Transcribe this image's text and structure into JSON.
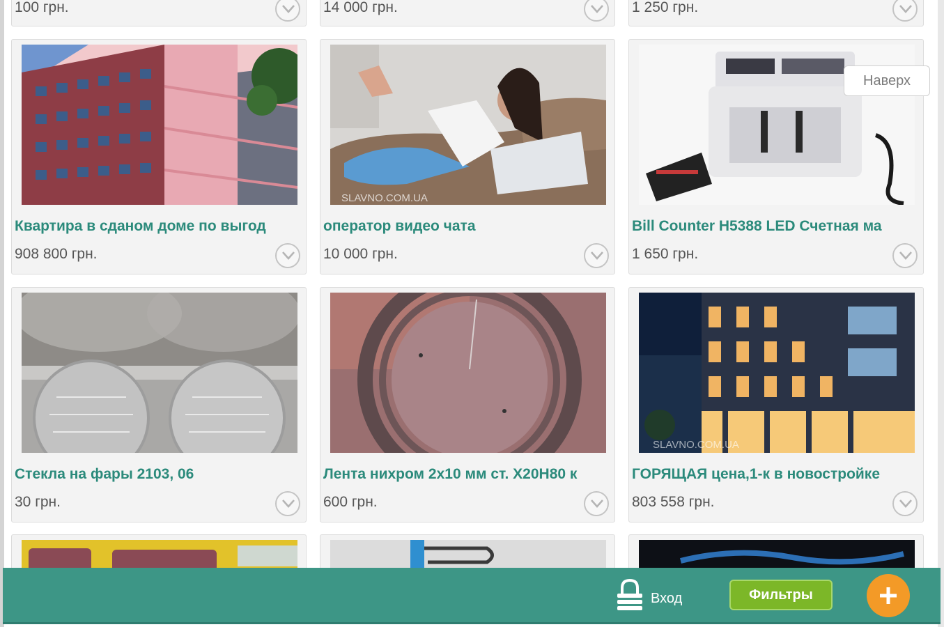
{
  "colors": {
    "title_text": "#2b8a7b",
    "price_text": "#555555",
    "bottom_bar": "#3d9686",
    "filters_button": "#7cb728",
    "add_button": "#f39a27"
  },
  "top_row": [
    {
      "price": "100 грн."
    },
    {
      "price": "14 000 грн."
    },
    {
      "price": "1 250 грн."
    }
  ],
  "listings": [
    {
      "title": "Квартира в сданом доме по выгод",
      "price": "908 800 грн.",
      "image": "building-photo"
    },
    {
      "title": "оператор видео чата",
      "price": "10 000 грн.",
      "image": "woman-laptop-photo",
      "watermark": "SLAVNO.COM.UA"
    },
    {
      "title": "Bill Counter H5388 LED Счетная ма",
      "price": "1 650 грн.",
      "image": "bill-counter-photo"
    },
    {
      "title": "Стекла на фары 2103, 06",
      "price": "30 грн.",
      "image": "headlight-glass-photo"
    },
    {
      "title": "Лента нихром 2х10 мм ст. Х20Н80 к",
      "price": "600 грн.",
      "image": "nichrome-coil-photo"
    },
    {
      "title": "ГОРЯЩАЯ цена,1-к в новостройке",
      "price": "803 558 грн.",
      "image": "night-building-photo",
      "watermark": "SLAVNO.COM.UA"
    }
  ],
  "to_top": {
    "label": "Наверх"
  },
  "bottom_bar": {
    "login_label": "Вход",
    "filters_label": "Фильтры",
    "add_icon": "plus-icon",
    "login_icon": "lock-icon"
  },
  "icons": {
    "more": "chevron-down-icon"
  }
}
